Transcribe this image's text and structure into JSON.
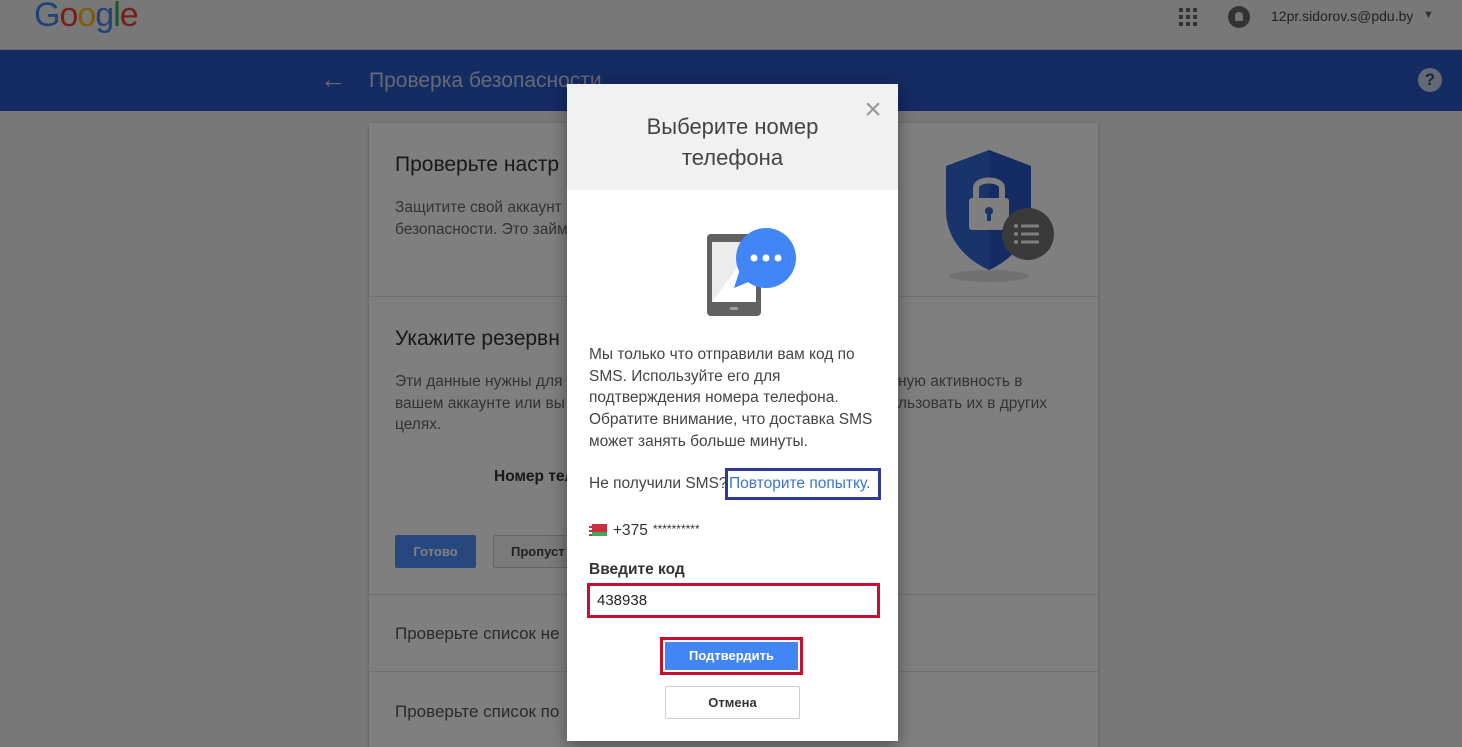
{
  "brand": {
    "letters": [
      {
        "ch": "G",
        "color": "#4285f4"
      },
      {
        "ch": "o",
        "color": "#ea4335"
      },
      {
        "ch": "o",
        "color": "#fbbc05"
      },
      {
        "ch": "g",
        "color": "#4285f4"
      },
      {
        "ch": "l",
        "color": "#34a853"
      },
      {
        "ch": "e",
        "color": "#ea4335"
      }
    ]
  },
  "header": {
    "account_email": "12pr.sidorov.s@pdu.by",
    "page_title": "Проверка безопасности"
  },
  "background": {
    "section1_title": "Проверьте настр",
    "section1_text_line1": "Защитите свой аккаунт",
    "section1_text_line2": "безопасности. Это займ",
    "section2_title": "Укажите резервн",
    "section2_text_left_line1": "Эти данные нужны для",
    "section2_text_left_line2": "вашем аккаунте или вы",
    "section2_text_left_line3": "целях.",
    "section2_text_right_line1": "ную активность в",
    "section2_text_right_line2": "льзовать их в других",
    "phone_label": "Номер тел",
    "ready_button": "Готово",
    "skip_button": "Пропуст",
    "section3_title": "Проверьте список не",
    "section4_title": "Проверьте список по"
  },
  "dialog": {
    "title": "Выберите номер телефона",
    "message": "Мы только что отправили вам код по SMS. Используйте его для подтверждения номера телефона. Обратите внимание, что доставка SMS может занять больше минуты.",
    "no_sms_text": "Не получили SMS?",
    "resend_link": "Повторите попытку.",
    "phone_prefix": "+375",
    "phone_masked": "**********",
    "code_label": "Введите код",
    "code_value": "438938",
    "confirm_button": "Подтвердить",
    "cancel_button": "Отмена"
  },
  "colors": {
    "header_blue": "#2a56c6",
    "primary_button": "#4285f4",
    "highlight_red": "#c8102e",
    "highlight_navy": "#2d3b92",
    "link": "#3b72d6"
  }
}
